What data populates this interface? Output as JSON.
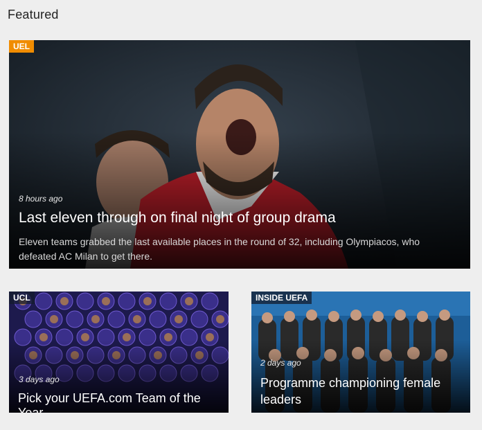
{
  "section": {
    "title": "Featured"
  },
  "cards": [
    {
      "badge": "UEL",
      "time": "8 hours ago",
      "headline": "Last eleven through on final night of group drama",
      "summary": "Eleven teams grabbed the last available places in the round of 32, including Olympiacos, who defeated AC Milan to get there."
    },
    {
      "badge": "UCL",
      "time": "3 days ago",
      "headline": "Pick your UEFA.com Team of the Year"
    },
    {
      "badge": "INSIDE UEFA",
      "time": "2 days ago",
      "headline": "Programme championing female leaders"
    }
  ],
  "colors": {
    "uel_badge": "#f08c00",
    "page_bg": "#eeeeee"
  }
}
